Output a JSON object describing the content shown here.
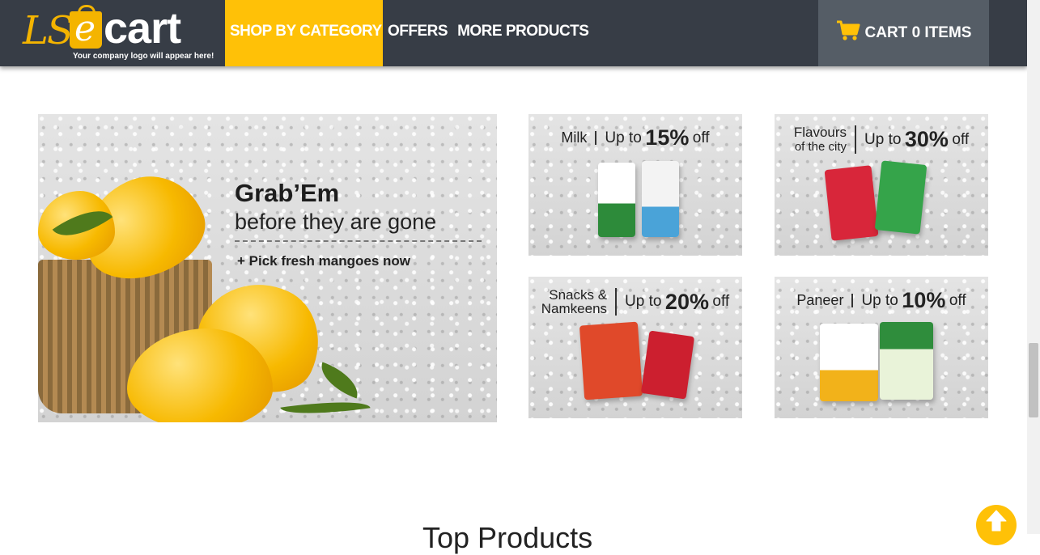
{
  "brand": {
    "logo_ls": "LS",
    "logo_e": "e",
    "logo_cart": "cart",
    "tagline": "Your company logo will appear here!",
    "accent_color": "#ffc107",
    "header_color": "#373d46"
  },
  "nav": {
    "items": [
      {
        "label": "SHOP BY CATEGORY",
        "active": true
      },
      {
        "label": "OFFERS",
        "active": false
      },
      {
        "label": "MORE PRODUCTS",
        "active": false
      }
    ]
  },
  "cart": {
    "icon": "shopping-cart-icon",
    "label": "CART 0 ITEMS"
  },
  "hero": {
    "title": "Grab’Em",
    "subtitle": "before they are gone",
    "cta": "+  Pick fresh mangoes now"
  },
  "promos": [
    {
      "name": "Milk",
      "upto": "Up to",
      "pct": "15%",
      "off": "off"
    },
    {
      "name_line1": "Flavours",
      "name_line2": "of the city",
      "upto": "Up to",
      "pct": "30%",
      "off": "off"
    },
    {
      "name_line1": "Snacks &",
      "name_line2": "Namkeens",
      "upto": "Up to",
      "pct": "20%",
      "off": "off"
    },
    {
      "name": "Paneer",
      "upto": "Up to",
      "pct": "10%",
      "off": "off"
    }
  ],
  "section": {
    "title": "Top Products"
  },
  "back_to_top": {
    "icon": "arrow-up-icon"
  }
}
